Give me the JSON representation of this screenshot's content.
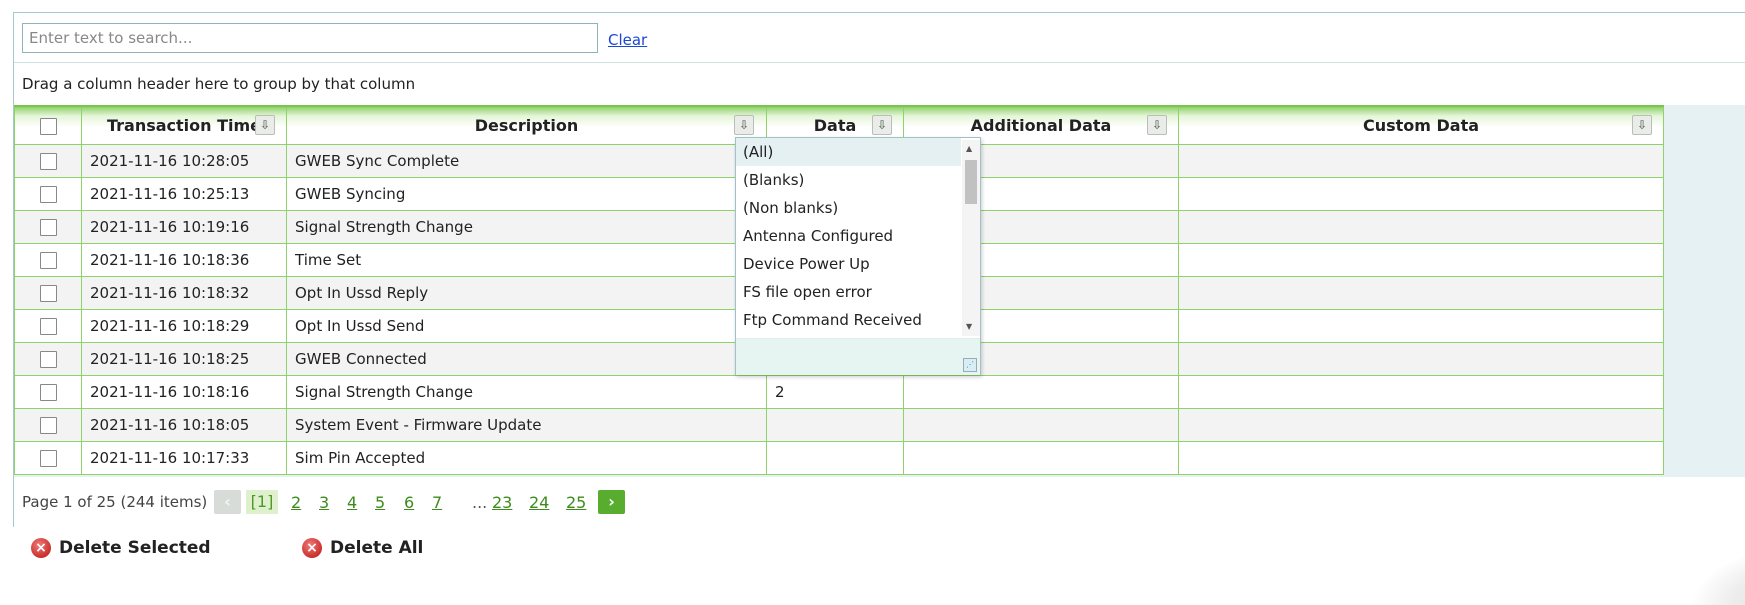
{
  "search": {
    "placeholder": "Enter text to search...",
    "clear_label": "Clear"
  },
  "group_panel": {
    "text": "Drag a column header here to group by that column"
  },
  "columns": [
    {
      "key": "select",
      "label": ""
    },
    {
      "key": "time",
      "label": "Transaction Time"
    },
    {
      "key": "desc",
      "label": "Description"
    },
    {
      "key": "data",
      "label": "Data"
    },
    {
      "key": "add",
      "label": "Additional Data"
    },
    {
      "key": "custom",
      "label": "Custom Data"
    }
  ],
  "rows": [
    {
      "time": "2021-11-16 10:28:05",
      "desc": "GWEB Sync Complete",
      "data": "",
      "add": "",
      "custom": ""
    },
    {
      "time": "2021-11-16 10:25:13",
      "desc": "GWEB Syncing",
      "data": "",
      "add": "",
      "custom": ""
    },
    {
      "time": "2021-11-16 10:19:16",
      "desc": "Signal Strength Change",
      "data": "",
      "add": "",
      "custom": ""
    },
    {
      "time": "2021-11-16 10:18:36",
      "desc": "Time Set",
      "data": "",
      "add": "",
      "custom": ""
    },
    {
      "time": "2021-11-16 10:18:32",
      "desc": "Opt In Ussd Reply",
      "data": "",
      "add": "",
      "custom": ""
    },
    {
      "time": "2021-11-16 10:18:29",
      "desc": "Opt In Ussd Send",
      "data": "",
      "add": "",
      "custom": ""
    },
    {
      "time": "2021-11-16 10:18:25",
      "desc": "GWEB Connected",
      "data": "",
      "add": "",
      "custom": ""
    },
    {
      "time": "2021-11-16 10:18:16",
      "desc": "Signal Strength Change",
      "data": "2",
      "add": "",
      "custom": ""
    },
    {
      "time": "2021-11-16 10:18:05",
      "desc": "System Event - Firmware Update",
      "data": "",
      "add": "",
      "custom": ""
    },
    {
      "time": "2021-11-16 10:17:33",
      "desc": "Sim Pin Accepted",
      "data": "",
      "add": "",
      "custom": ""
    }
  ],
  "filter_dropdown": {
    "items": [
      "(All)",
      "(Blanks)",
      "(Non blanks)",
      "Antenna Configured",
      "Device Power Up",
      "FS file open error",
      "Ftp Command Received"
    ],
    "selected_index": 0
  },
  "pager": {
    "summary": "Page 1 of 25 (244 items)",
    "prev_label": "‹",
    "next_label": "›",
    "current_label": "[1]",
    "pages_before": [
      "2",
      "3",
      "4",
      "5",
      "6",
      "7"
    ],
    "ellipsis": "...",
    "pages_after": [
      "23",
      "24",
      "25"
    ]
  },
  "actions": {
    "delete_selected": "Delete Selected",
    "delete_all": "Delete All"
  },
  "icons": {
    "filter": "filter-dropdown-icon",
    "delete": "delete-x-icon"
  },
  "colors": {
    "header_green": "#8fd26a",
    "link_blue": "#1b46d6",
    "pager_green": "#58ad2e",
    "delete_red": "#c9302c"
  }
}
